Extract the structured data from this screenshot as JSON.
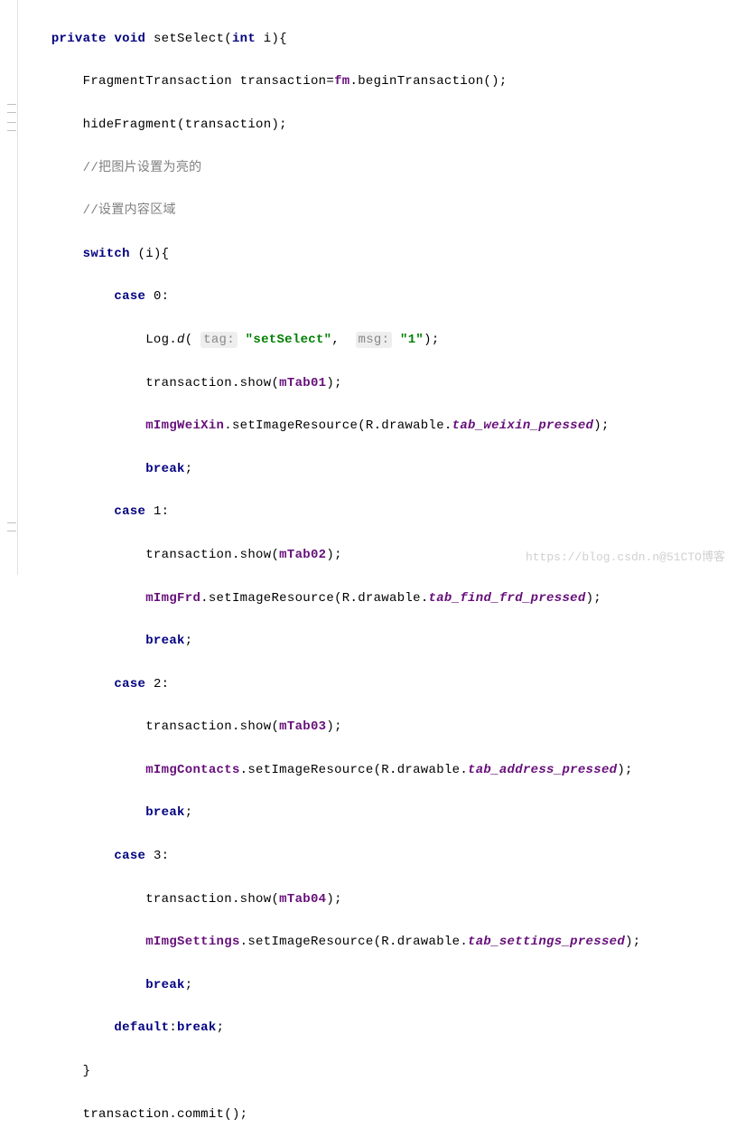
{
  "code": {
    "l1": {
      "kw1": "private",
      "kw2": "void",
      "method": "setSelect",
      "kw3": "int",
      "param": "i"
    },
    "l2": {
      "type": "FragmentTransaction",
      "var": "transaction",
      "field": "fm",
      "call": "beginTransaction"
    },
    "l3": {
      "call": "hideFragment",
      "arg": "transaction"
    },
    "l4": "//把图片设置为亮的",
    "l5": "//设置内容区域",
    "l6": {
      "kw": "switch",
      "var": "i"
    },
    "l7": {
      "kw": "case",
      "val": "0"
    },
    "l8": {
      "cls": "Log",
      "method": "d",
      "hint1": "tag:",
      "str1": "\"setSelect\"",
      "hint2": "msg:",
      "str2": "\"1\""
    },
    "l9": {
      "obj": "transaction",
      "method": "show",
      "arg": "mTab01"
    },
    "l10": {
      "field": "mImgWeiXin",
      "method": "setImageResource",
      "cls": "R",
      "sub": "drawable",
      "res": "tab_weixin_pressed"
    },
    "l11": {
      "kw": "break"
    },
    "l12": {
      "kw": "case",
      "val": "1"
    },
    "l13": {
      "obj": "transaction",
      "method": "show",
      "arg": "mTab02"
    },
    "l14": {
      "field": "mImgFrd",
      "method": "setImageResource",
      "cls": "R",
      "sub": "drawable",
      "res": "tab_find_frd_pressed"
    },
    "l15": {
      "kw": "break"
    },
    "l16": {
      "kw": "case",
      "val": "2"
    },
    "l17": {
      "obj": "transaction",
      "method": "show",
      "arg": "mTab03"
    },
    "l18": {
      "field": "mImgContacts",
      "method": "setImageResource",
      "cls": "R",
      "sub": "drawable",
      "res": "tab_address_pressed"
    },
    "l19": {
      "kw": "break"
    },
    "l20": {
      "kw": "case",
      "val": "3"
    },
    "l21": {
      "obj": "transaction",
      "method": "show",
      "arg": "mTab04"
    },
    "l22": {
      "field": "mImgSettings",
      "method": "setImageResource",
      "cls": "R",
      "sub": "drawable",
      "res": "tab_settings_pressed"
    },
    "l23": {
      "kw": "break"
    },
    "l24": {
      "kw1": "default",
      "kw2": "break"
    },
    "l25": "}",
    "l26": {
      "obj": "transaction",
      "method": "commit"
    }
  },
  "watermark": "https://blog.csdn.n@51CTO博客"
}
